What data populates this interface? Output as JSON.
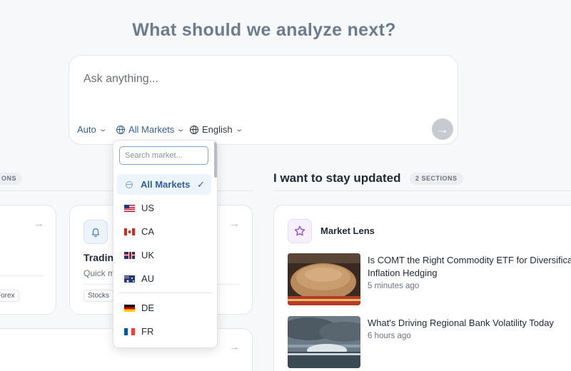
{
  "heading": "What should we analyze next?",
  "ask": {
    "placeholder": "Ask anything...",
    "mode_label": "Auto",
    "markets_label": "All Markets",
    "language_label": "English"
  },
  "left_section": {
    "badge": "ONS",
    "cards": [
      {
        "tags": [
          "Forex"
        ]
      },
      {
        "title": "Tradin",
        "subtitle": "Quick m",
        "tags": [
          "Stocks"
        ]
      }
    ]
  },
  "right_section": {
    "heading": "I want to stay updated",
    "badge": "2 SECTIONS",
    "card": {
      "title": "Market Lens",
      "articles": [
        {
          "title_line1": "Is COMT the Right Commodity ETF for Diversifica",
          "title_line2": "Inflation Hedging",
          "time": "5 minutes ago"
        },
        {
          "title_line1": "What's Driving Regional Bank Volatility Today",
          "title_line2": "",
          "time": "6 hours ago"
        }
      ]
    }
  },
  "dropdown": {
    "search_placeholder": "Search market...",
    "items": [
      {
        "label": "All Markets",
        "icon": "globe-icon",
        "selected": true
      },
      {
        "label": "US",
        "icon": "flag-us-icon"
      },
      {
        "label": "CA",
        "icon": "flag-ca-icon"
      },
      {
        "label": "UK",
        "icon": "flag-uk-icon"
      },
      {
        "label": "AU",
        "icon": "flag-au-icon"
      },
      {
        "label": "DE",
        "icon": "flag-de-icon"
      },
      {
        "label": "FR",
        "icon": "flag-fr-icon"
      }
    ]
  },
  "colors": {
    "accent": "#2f5f9e",
    "heading": "#6b7c8e",
    "background": "#f7f8fa"
  }
}
